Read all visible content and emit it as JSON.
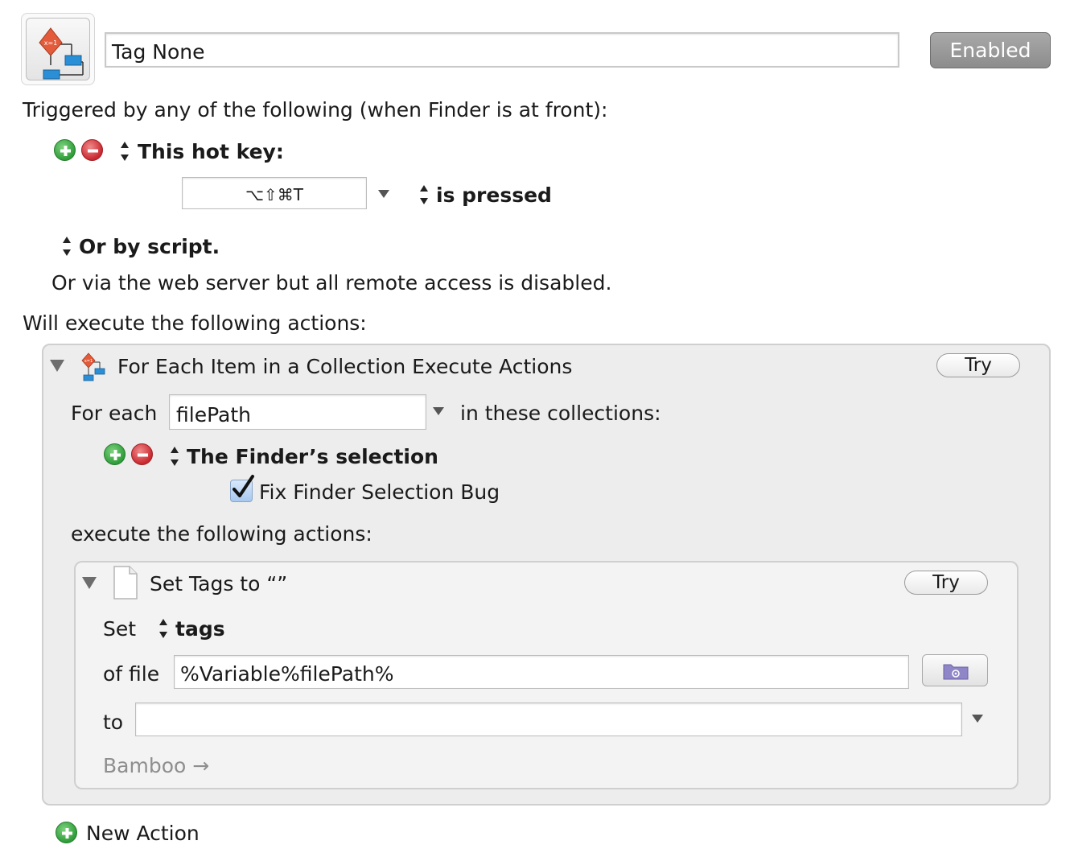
{
  "header": {
    "macro_name": "Tag None",
    "enabled_label": "Enabled",
    "icon": "macro-flowchart-icon"
  },
  "triggers": {
    "intro": "Triggered by any of the following (when Finder is at front):",
    "hotkey_title": "This hot key:",
    "hotkey_value": "⌥⇧⌘T",
    "hotkey_condition": "is pressed",
    "script_label": "Or by script.",
    "web_server_text": "Or via the web server but all remote access is disabled."
  },
  "actions_intro": "Will execute the following actions:",
  "for_each_action": {
    "title": "For Each Item in a Collection Execute Actions",
    "try_label": "Try",
    "for_each_label": "For each",
    "variable_value": "filePath",
    "collections_label": "in these collections:",
    "collection_item": "The Finder’s selection",
    "fix_bug_label": "Fix Finder Selection Bug",
    "fix_bug_checked": true,
    "execute_label": "execute the following actions:"
  },
  "set_tags_action": {
    "title": "Set Tags to “”",
    "try_label": "Try",
    "set_label": "Set",
    "set_attribute": "tags",
    "of_file_label": "of file",
    "file_value": "%Variable%filePath%",
    "to_label": "to",
    "to_value": "",
    "suggestion": "Bamboo →"
  },
  "new_action_label": "New Action",
  "colors": {
    "add_green": "#2e9d39",
    "remove_red": "#c9282f",
    "enabled_gray": "#8c8c8c"
  }
}
